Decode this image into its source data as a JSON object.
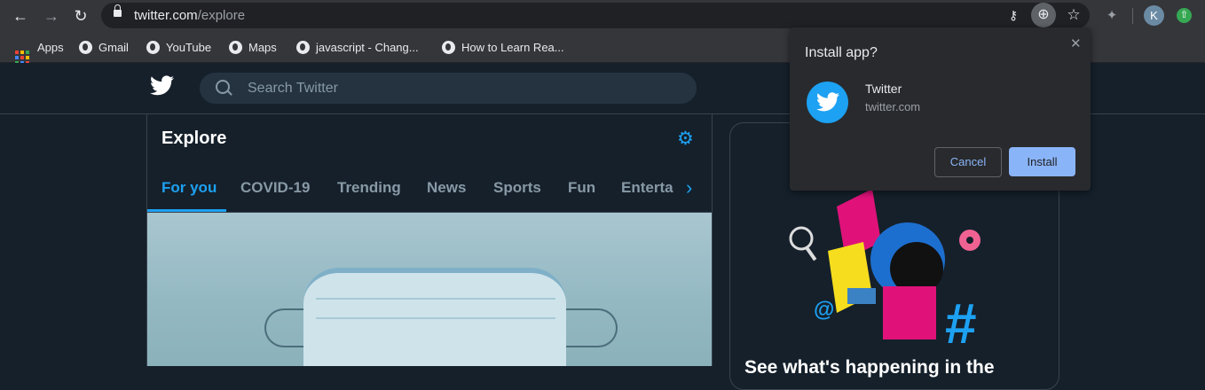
{
  "browser": {
    "url_host": "twitter.com",
    "url_path": "/explore",
    "profile_initial": "K"
  },
  "bookmarks": [
    {
      "label": "Apps"
    },
    {
      "label": "Gmail"
    },
    {
      "label": "YouTube"
    },
    {
      "label": "Maps"
    },
    {
      "label": "javascript - Chang..."
    },
    {
      "label": "How to Learn Rea..."
    }
  ],
  "twitter": {
    "search_placeholder": "Search Twitter",
    "page_title": "Explore",
    "tabs": [
      {
        "label": "For you",
        "active": true
      },
      {
        "label": "COVID-19"
      },
      {
        "label": "Trending"
      },
      {
        "label": "News"
      },
      {
        "label": "Sports"
      },
      {
        "label": "Fun"
      },
      {
        "label": "Enterta"
      }
    ],
    "side_card_text": "See what's happening in the"
  },
  "install_popup": {
    "title": "Install app?",
    "app_name": "Twitter",
    "app_url": "twitter.com",
    "cancel_label": "Cancel",
    "install_label": "Install"
  },
  "colors": {
    "twitter_blue": "#1da1f2",
    "page_bg": "#15202b",
    "chrome_toolbar": "#35363a",
    "install_button": "#8ab4f8"
  },
  "icons": [
    "back-icon",
    "forward-icon",
    "reload-icon",
    "lock-icon",
    "key-icon",
    "install-icon",
    "star-icon",
    "extensions-icon",
    "avatar",
    "update-icon",
    "apps-icon",
    "globe-icon",
    "twitter-bird-icon",
    "search-icon",
    "settings-gear-icon",
    "chevron-right-icon",
    "close-icon"
  ]
}
